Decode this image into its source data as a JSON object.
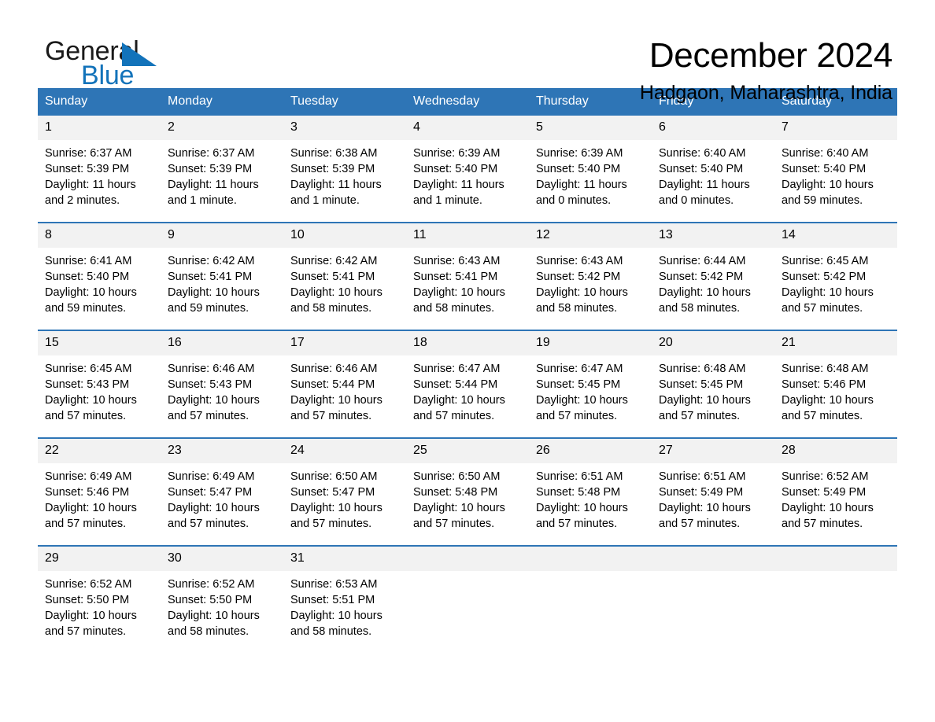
{
  "brand": {
    "name_part1": "General",
    "name_part2": "Blue",
    "triangle_icon": "brand-triangle-icon",
    "accent_color": "#1373ba"
  },
  "header": {
    "title": "December 2024",
    "location": "Hadgaon, Maharashtra, India"
  },
  "calendar": {
    "header_bg": "#2e75b6",
    "daynum_bg": "#f2f2f2",
    "weekday_headers": [
      "Sunday",
      "Monday",
      "Tuesday",
      "Wednesday",
      "Thursday",
      "Friday",
      "Saturday"
    ],
    "weeks": [
      [
        {
          "day": "1",
          "sunrise": "Sunrise: 6:37 AM",
          "sunset": "Sunset: 5:39 PM",
          "daylight": "Daylight: 11 hours and 2 minutes."
        },
        {
          "day": "2",
          "sunrise": "Sunrise: 6:37 AM",
          "sunset": "Sunset: 5:39 PM",
          "daylight": "Daylight: 11 hours and 1 minute."
        },
        {
          "day": "3",
          "sunrise": "Sunrise: 6:38 AM",
          "sunset": "Sunset: 5:39 PM",
          "daylight": "Daylight: 11 hours and 1 minute."
        },
        {
          "day": "4",
          "sunrise": "Sunrise: 6:39 AM",
          "sunset": "Sunset: 5:40 PM",
          "daylight": "Daylight: 11 hours and 1 minute."
        },
        {
          "day": "5",
          "sunrise": "Sunrise: 6:39 AM",
          "sunset": "Sunset: 5:40 PM",
          "daylight": "Daylight: 11 hours and 0 minutes."
        },
        {
          "day": "6",
          "sunrise": "Sunrise: 6:40 AM",
          "sunset": "Sunset: 5:40 PM",
          "daylight": "Daylight: 11 hours and 0 minutes."
        },
        {
          "day": "7",
          "sunrise": "Sunrise: 6:40 AM",
          "sunset": "Sunset: 5:40 PM",
          "daylight": "Daylight: 10 hours and 59 minutes."
        }
      ],
      [
        {
          "day": "8",
          "sunrise": "Sunrise: 6:41 AM",
          "sunset": "Sunset: 5:40 PM",
          "daylight": "Daylight: 10 hours and 59 minutes."
        },
        {
          "day": "9",
          "sunrise": "Sunrise: 6:42 AM",
          "sunset": "Sunset: 5:41 PM",
          "daylight": "Daylight: 10 hours and 59 minutes."
        },
        {
          "day": "10",
          "sunrise": "Sunrise: 6:42 AM",
          "sunset": "Sunset: 5:41 PM",
          "daylight": "Daylight: 10 hours and 58 minutes."
        },
        {
          "day": "11",
          "sunrise": "Sunrise: 6:43 AM",
          "sunset": "Sunset: 5:41 PM",
          "daylight": "Daylight: 10 hours and 58 minutes."
        },
        {
          "day": "12",
          "sunrise": "Sunrise: 6:43 AM",
          "sunset": "Sunset: 5:42 PM",
          "daylight": "Daylight: 10 hours and 58 minutes."
        },
        {
          "day": "13",
          "sunrise": "Sunrise: 6:44 AM",
          "sunset": "Sunset: 5:42 PM",
          "daylight": "Daylight: 10 hours and 58 minutes."
        },
        {
          "day": "14",
          "sunrise": "Sunrise: 6:45 AM",
          "sunset": "Sunset: 5:42 PM",
          "daylight": "Daylight: 10 hours and 57 minutes."
        }
      ],
      [
        {
          "day": "15",
          "sunrise": "Sunrise: 6:45 AM",
          "sunset": "Sunset: 5:43 PM",
          "daylight": "Daylight: 10 hours and 57 minutes."
        },
        {
          "day": "16",
          "sunrise": "Sunrise: 6:46 AM",
          "sunset": "Sunset: 5:43 PM",
          "daylight": "Daylight: 10 hours and 57 minutes."
        },
        {
          "day": "17",
          "sunrise": "Sunrise: 6:46 AM",
          "sunset": "Sunset: 5:44 PM",
          "daylight": "Daylight: 10 hours and 57 minutes."
        },
        {
          "day": "18",
          "sunrise": "Sunrise: 6:47 AM",
          "sunset": "Sunset: 5:44 PM",
          "daylight": "Daylight: 10 hours and 57 minutes."
        },
        {
          "day": "19",
          "sunrise": "Sunrise: 6:47 AM",
          "sunset": "Sunset: 5:45 PM",
          "daylight": "Daylight: 10 hours and 57 minutes."
        },
        {
          "day": "20",
          "sunrise": "Sunrise: 6:48 AM",
          "sunset": "Sunset: 5:45 PM",
          "daylight": "Daylight: 10 hours and 57 minutes."
        },
        {
          "day": "21",
          "sunrise": "Sunrise: 6:48 AM",
          "sunset": "Sunset: 5:46 PM",
          "daylight": "Daylight: 10 hours and 57 minutes."
        }
      ],
      [
        {
          "day": "22",
          "sunrise": "Sunrise: 6:49 AM",
          "sunset": "Sunset: 5:46 PM",
          "daylight": "Daylight: 10 hours and 57 minutes."
        },
        {
          "day": "23",
          "sunrise": "Sunrise: 6:49 AM",
          "sunset": "Sunset: 5:47 PM",
          "daylight": "Daylight: 10 hours and 57 minutes."
        },
        {
          "day": "24",
          "sunrise": "Sunrise: 6:50 AM",
          "sunset": "Sunset: 5:47 PM",
          "daylight": "Daylight: 10 hours and 57 minutes."
        },
        {
          "day": "25",
          "sunrise": "Sunrise: 6:50 AM",
          "sunset": "Sunset: 5:48 PM",
          "daylight": "Daylight: 10 hours and 57 minutes."
        },
        {
          "day": "26",
          "sunrise": "Sunrise: 6:51 AM",
          "sunset": "Sunset: 5:48 PM",
          "daylight": "Daylight: 10 hours and 57 minutes."
        },
        {
          "day": "27",
          "sunrise": "Sunrise: 6:51 AM",
          "sunset": "Sunset: 5:49 PM",
          "daylight": "Daylight: 10 hours and 57 minutes."
        },
        {
          "day": "28",
          "sunrise": "Sunrise: 6:52 AM",
          "sunset": "Sunset: 5:49 PM",
          "daylight": "Daylight: 10 hours and 57 minutes."
        }
      ],
      [
        {
          "day": "29",
          "sunrise": "Sunrise: 6:52 AM",
          "sunset": "Sunset: 5:50 PM",
          "daylight": "Daylight: 10 hours and 57 minutes."
        },
        {
          "day": "30",
          "sunrise": "Sunrise: 6:52 AM",
          "sunset": "Sunset: 5:50 PM",
          "daylight": "Daylight: 10 hours and 58 minutes."
        },
        {
          "day": "31",
          "sunrise": "Sunrise: 6:53 AM",
          "sunset": "Sunset: 5:51 PM",
          "daylight": "Daylight: 10 hours and 58 minutes."
        },
        {
          "day": "",
          "sunrise": "",
          "sunset": "",
          "daylight": ""
        },
        {
          "day": "",
          "sunrise": "",
          "sunset": "",
          "daylight": ""
        },
        {
          "day": "",
          "sunrise": "",
          "sunset": "",
          "daylight": ""
        },
        {
          "day": "",
          "sunrise": "",
          "sunset": "",
          "daylight": ""
        }
      ]
    ]
  }
}
